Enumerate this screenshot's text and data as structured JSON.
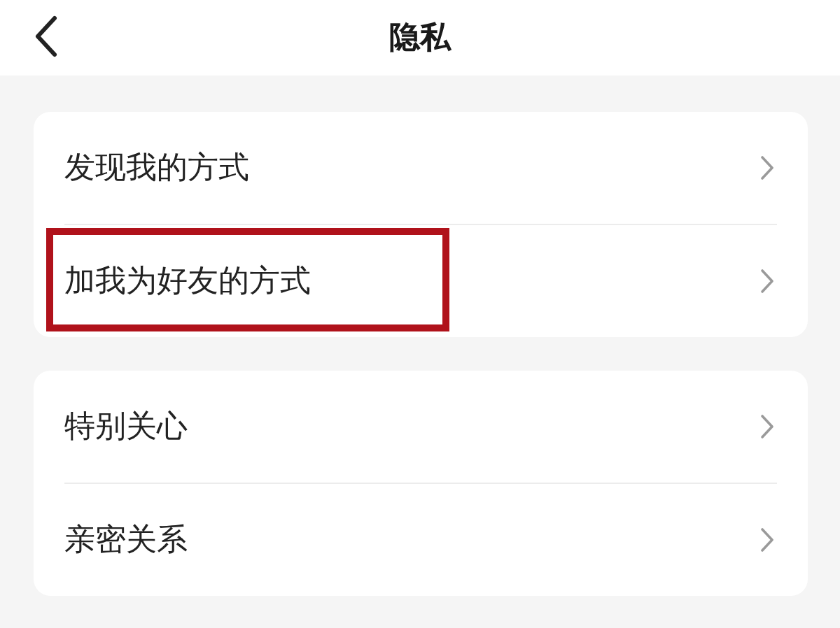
{
  "header": {
    "title": "隐私"
  },
  "groups": [
    {
      "items": [
        {
          "label": "发现我的方式",
          "highlighted": false
        },
        {
          "label": "加我为好友的方式",
          "highlighted": true
        }
      ]
    },
    {
      "items": [
        {
          "label": "特别关心",
          "highlighted": false
        },
        {
          "label": "亲密关系",
          "highlighted": false
        }
      ]
    }
  ]
}
